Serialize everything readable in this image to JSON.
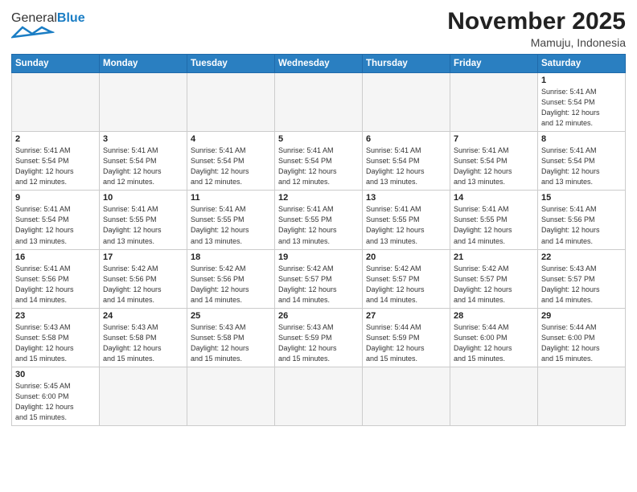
{
  "logo": {
    "text_general": "General",
    "text_blue": "Blue"
  },
  "header": {
    "month_year": "November 2025",
    "location": "Mamuju, Indonesia"
  },
  "days_of_week": [
    "Sunday",
    "Monday",
    "Tuesday",
    "Wednesday",
    "Thursday",
    "Friday",
    "Saturday"
  ],
  "weeks": [
    [
      {
        "day": "",
        "info": ""
      },
      {
        "day": "",
        "info": ""
      },
      {
        "day": "",
        "info": ""
      },
      {
        "day": "",
        "info": ""
      },
      {
        "day": "",
        "info": ""
      },
      {
        "day": "",
        "info": ""
      },
      {
        "day": "1",
        "info": "Sunrise: 5:41 AM\nSunset: 5:54 PM\nDaylight: 12 hours\nand 12 minutes."
      }
    ],
    [
      {
        "day": "2",
        "info": "Sunrise: 5:41 AM\nSunset: 5:54 PM\nDaylight: 12 hours\nand 12 minutes."
      },
      {
        "day": "3",
        "info": "Sunrise: 5:41 AM\nSunset: 5:54 PM\nDaylight: 12 hours\nand 12 minutes."
      },
      {
        "day": "4",
        "info": "Sunrise: 5:41 AM\nSunset: 5:54 PM\nDaylight: 12 hours\nand 12 minutes."
      },
      {
        "day": "5",
        "info": "Sunrise: 5:41 AM\nSunset: 5:54 PM\nDaylight: 12 hours\nand 12 minutes."
      },
      {
        "day": "6",
        "info": "Sunrise: 5:41 AM\nSunset: 5:54 PM\nDaylight: 12 hours\nand 13 minutes."
      },
      {
        "day": "7",
        "info": "Sunrise: 5:41 AM\nSunset: 5:54 PM\nDaylight: 12 hours\nand 13 minutes."
      },
      {
        "day": "8",
        "info": "Sunrise: 5:41 AM\nSunset: 5:54 PM\nDaylight: 12 hours\nand 13 minutes."
      }
    ],
    [
      {
        "day": "9",
        "info": "Sunrise: 5:41 AM\nSunset: 5:54 PM\nDaylight: 12 hours\nand 13 minutes."
      },
      {
        "day": "10",
        "info": "Sunrise: 5:41 AM\nSunset: 5:55 PM\nDaylight: 12 hours\nand 13 minutes."
      },
      {
        "day": "11",
        "info": "Sunrise: 5:41 AM\nSunset: 5:55 PM\nDaylight: 12 hours\nand 13 minutes."
      },
      {
        "day": "12",
        "info": "Sunrise: 5:41 AM\nSunset: 5:55 PM\nDaylight: 12 hours\nand 13 minutes."
      },
      {
        "day": "13",
        "info": "Sunrise: 5:41 AM\nSunset: 5:55 PM\nDaylight: 12 hours\nand 13 minutes."
      },
      {
        "day": "14",
        "info": "Sunrise: 5:41 AM\nSunset: 5:55 PM\nDaylight: 12 hours\nand 14 minutes."
      },
      {
        "day": "15",
        "info": "Sunrise: 5:41 AM\nSunset: 5:56 PM\nDaylight: 12 hours\nand 14 minutes."
      }
    ],
    [
      {
        "day": "16",
        "info": "Sunrise: 5:41 AM\nSunset: 5:56 PM\nDaylight: 12 hours\nand 14 minutes."
      },
      {
        "day": "17",
        "info": "Sunrise: 5:42 AM\nSunset: 5:56 PM\nDaylight: 12 hours\nand 14 minutes."
      },
      {
        "day": "18",
        "info": "Sunrise: 5:42 AM\nSunset: 5:56 PM\nDaylight: 12 hours\nand 14 minutes."
      },
      {
        "day": "19",
        "info": "Sunrise: 5:42 AM\nSunset: 5:57 PM\nDaylight: 12 hours\nand 14 minutes."
      },
      {
        "day": "20",
        "info": "Sunrise: 5:42 AM\nSunset: 5:57 PM\nDaylight: 12 hours\nand 14 minutes."
      },
      {
        "day": "21",
        "info": "Sunrise: 5:42 AM\nSunset: 5:57 PM\nDaylight: 12 hours\nand 14 minutes."
      },
      {
        "day": "22",
        "info": "Sunrise: 5:43 AM\nSunset: 5:57 PM\nDaylight: 12 hours\nand 14 minutes."
      }
    ],
    [
      {
        "day": "23",
        "info": "Sunrise: 5:43 AM\nSunset: 5:58 PM\nDaylight: 12 hours\nand 15 minutes."
      },
      {
        "day": "24",
        "info": "Sunrise: 5:43 AM\nSunset: 5:58 PM\nDaylight: 12 hours\nand 15 minutes."
      },
      {
        "day": "25",
        "info": "Sunrise: 5:43 AM\nSunset: 5:58 PM\nDaylight: 12 hours\nand 15 minutes."
      },
      {
        "day": "26",
        "info": "Sunrise: 5:43 AM\nSunset: 5:59 PM\nDaylight: 12 hours\nand 15 minutes."
      },
      {
        "day": "27",
        "info": "Sunrise: 5:44 AM\nSunset: 5:59 PM\nDaylight: 12 hours\nand 15 minutes."
      },
      {
        "day": "28",
        "info": "Sunrise: 5:44 AM\nSunset: 6:00 PM\nDaylight: 12 hours\nand 15 minutes."
      },
      {
        "day": "29",
        "info": "Sunrise: 5:44 AM\nSunset: 6:00 PM\nDaylight: 12 hours\nand 15 minutes."
      }
    ],
    [
      {
        "day": "30",
        "info": "Sunrise: 5:45 AM\nSunset: 6:00 PM\nDaylight: 12 hours\nand 15 minutes."
      },
      {
        "day": "",
        "info": ""
      },
      {
        "day": "",
        "info": ""
      },
      {
        "day": "",
        "info": ""
      },
      {
        "day": "",
        "info": ""
      },
      {
        "day": "",
        "info": ""
      },
      {
        "day": "",
        "info": ""
      }
    ]
  ]
}
